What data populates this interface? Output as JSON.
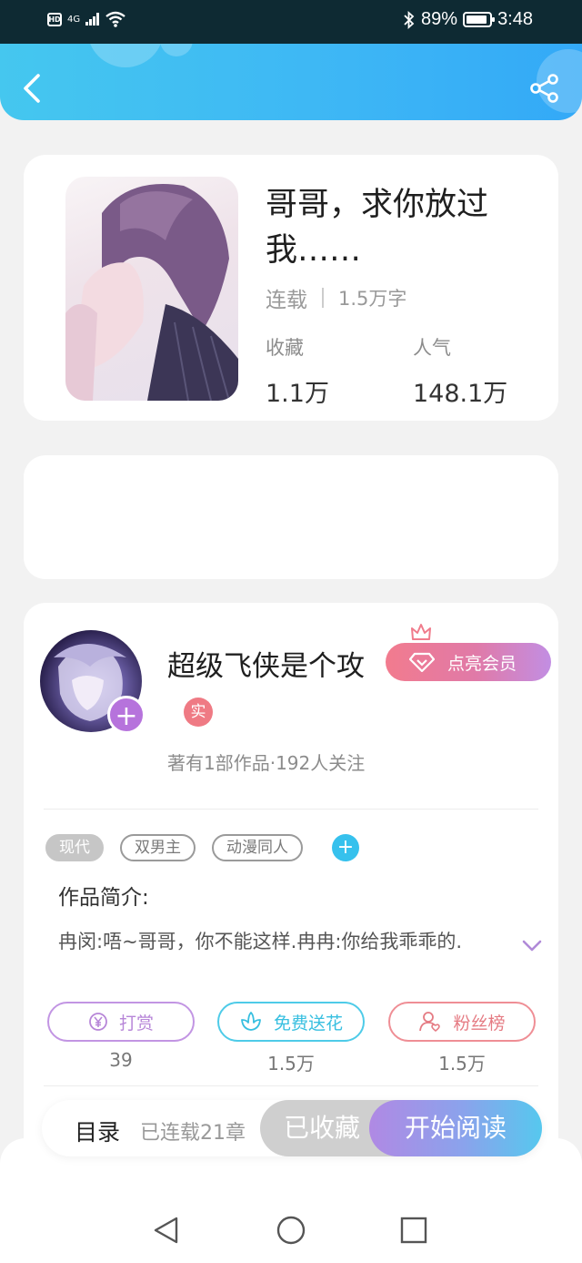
{
  "status_bar": {
    "network": "4G",
    "battery": "89%",
    "time": "3:48"
  },
  "header": {
    "back_icon": "chevron-left-icon",
    "share_icon": "share-icon"
  },
  "book": {
    "title": "哥哥，求你放过我……",
    "status": "连载",
    "word_count": "1.5万字",
    "favorites_label": "收藏",
    "favorites_value": "1.1万",
    "popularity_label": "人气",
    "popularity_value": "148.1万"
  },
  "author": {
    "name": "超级飞侠是个攻",
    "vip_button": "点亮会员",
    "real_badge": "实",
    "info": "著有1部作品·192人关注"
  },
  "tags": [
    "现代",
    "双男主",
    "动漫同人"
  ],
  "intro": {
    "title": "作品简介:",
    "text": "冉闵:唔~哥哥，你不能这样.冉冉:你给我乖乖的."
  },
  "actions": [
    {
      "label": "打赏",
      "count": "39",
      "icon": "yen-icon"
    },
    {
      "label": "免费送花",
      "count": "1.5万",
      "icon": "flower-icon"
    },
    {
      "label": "粉丝榜",
      "count": "1.5万",
      "icon": "fans-icon"
    }
  ],
  "bottom_bar": {
    "toc": "目录",
    "chapters": "已连载21章",
    "collected": "已收藏",
    "start_reading": "开始阅读"
  },
  "colors": {
    "header_gradient_start": "#45c7ef",
    "header_gradient_end": "#33a9f7",
    "vip_gradient_start": "#f27b8e",
    "vip_gradient_end": "#c28ee3",
    "read_gradient_start": "#b089e4",
    "read_gradient_end": "#56c8ee"
  }
}
